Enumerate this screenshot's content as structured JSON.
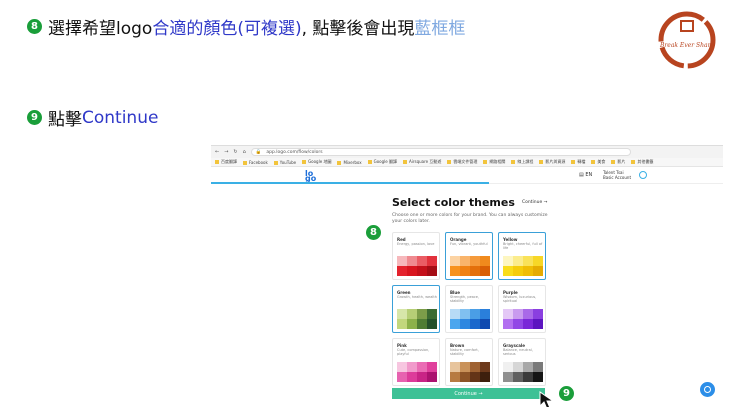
{
  "slide": {
    "step1": {
      "num": "8",
      "pre": "選擇希望logo",
      "blue": "合適的顏色(可複選)",
      "post": ", 點擊後會出現",
      "lightblue": "藍框框"
    },
    "step2": {
      "num": "9",
      "pre": "點擊",
      "blue": "Continue"
    },
    "stamp": {
      "line1": "Break Ever Share"
    }
  },
  "browser": {
    "url": "app.logo.com/flow/colors",
    "bookmarks": [
      "百度翻譯",
      "Facebook",
      "YouTube",
      "Google 地圖",
      "Mixerbox",
      "Google 翻譯",
      "Airsquare 互動遊",
      "雲端文件管理",
      "網路相關",
      "線上課程",
      "影片與資源",
      "轉檔",
      "美食",
      "影片",
      "其他書籤"
    ]
  },
  "app": {
    "logo_top": "lo",
    "logo_bottom": "go",
    "lang": "EN",
    "user_name": "Talent Tsai",
    "user_sub": "Basic Account",
    "title": "Select color themes",
    "continue_top": "Continue →",
    "subtitle": "Choose one or more colors for your brand. You can always customize your colors later.",
    "cta": "Continue  →",
    "callout_8": "8",
    "callout_9": "9"
  },
  "themes": [
    {
      "name": "Red",
      "desc": "Energy, passion, love",
      "selected": false,
      "colors": [
        "#f6b8bc",
        "#ef8a90",
        "#ea5c64",
        "#e2323c",
        "#e4222d",
        "#d8151f",
        "#c4101a",
        "#a50d15"
      ]
    },
    {
      "name": "Orange",
      "desc": "Fun, vibrant, youthful",
      "selected": true,
      "colors": [
        "#fcd3a3",
        "#f9b46b",
        "#f59a3b",
        "#f08a1d",
        "#f7921e",
        "#f08113",
        "#e4700b",
        "#d95f05"
      ]
    },
    {
      "name": "Yellow",
      "desc": "Bright, cheerful, full of life",
      "selected": true,
      "colors": [
        "#fdf6c0",
        "#fbec8c",
        "#f9e259",
        "#f7d727",
        "#f9dc1a",
        "#f5cc0b",
        "#f0bd05",
        "#e5ab02"
      ]
    },
    {
      "name": "Green",
      "desc": "Growth, health, wealth",
      "selected": true,
      "colors": [
        "#d7e6a9",
        "#b6ce76",
        "#7c9d49",
        "#3c6b32",
        "#c2d77d",
        "#8cb14a",
        "#4f7d33",
        "#24512a"
      ]
    },
    {
      "name": "Blue",
      "desc": "Strength, peace, stability",
      "selected": false,
      "colors": [
        "#b7dbf6",
        "#80c0f0",
        "#4a9ee6",
        "#2a7fdb",
        "#4ba6ee",
        "#2e87e0",
        "#1a68cc",
        "#0f4ab0"
      ]
    },
    {
      "name": "Purple",
      "desc": "Wisdom, luxurious, spiritual",
      "selected": false,
      "colors": [
        "#e4c8f6",
        "#c99bef",
        "#a969e8",
        "#8a3fe0",
        "#b26ff0",
        "#9247e6",
        "#7a27d8",
        "#5c14c0"
      ]
    },
    {
      "name": "Pink",
      "desc": "Cute, compassion, playful",
      "selected": false,
      "colors": [
        "#f7c6e0",
        "#f19acb",
        "#ea6cb4",
        "#e0409c",
        "#e762b0",
        "#dd3b9a",
        "#c92486",
        "#ab126f"
      ]
    },
    {
      "name": "Brown",
      "desc": "Nature, comfort, stability",
      "selected": false,
      "colors": [
        "#e7c49c",
        "#c9925a",
        "#9f6232",
        "#6d3a1c",
        "#b77b42",
        "#8d5427",
        "#643417",
        "#3d1f0d"
      ]
    },
    {
      "name": "Grayscale",
      "desc": "Balance, neutral, serious",
      "selected": false,
      "colors": [
        "#f0f0f0",
        "#d6d6d6",
        "#a8a8a8",
        "#7a7a7a",
        "#8f8f8f",
        "#606060",
        "#3a3a3a",
        "#141414"
      ]
    }
  ]
}
